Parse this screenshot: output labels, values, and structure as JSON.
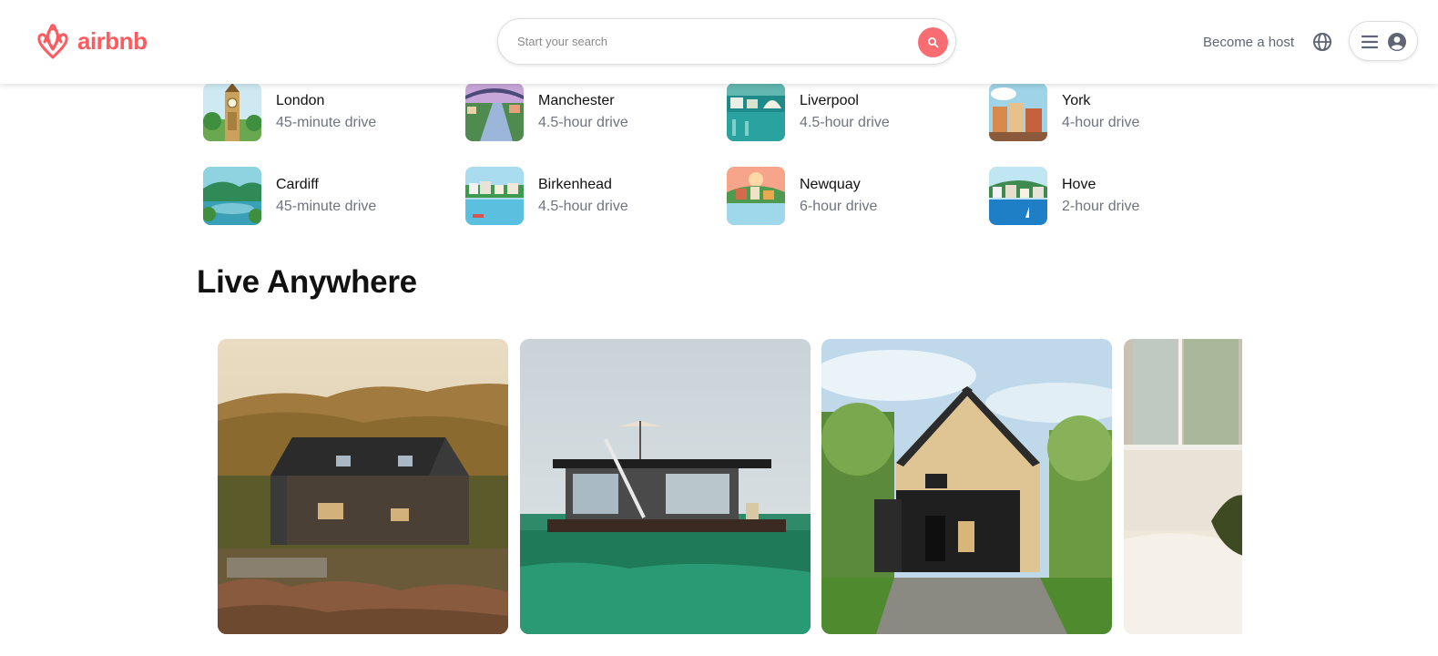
{
  "brand": {
    "name": "airbnb",
    "color": "#FF5A5F"
  },
  "header": {
    "search": {
      "placeholder": "Start your search",
      "button_icon": "search-icon",
      "button_color": "#F86D72"
    },
    "host_link": "Become a host",
    "globe_icon": "globe-icon",
    "menu_icon": "hamburger-menu-icon",
    "user_icon": "user-circle-icon"
  },
  "destinations": [
    {
      "city": "London",
      "distance": "45-minute drive"
    },
    {
      "city": "Manchester",
      "distance": "4.5-hour drive"
    },
    {
      "city": "Liverpool",
      "distance": "4.5-hour drive"
    },
    {
      "city": "York",
      "distance": "4-hour drive"
    },
    {
      "city": "Cardiff",
      "distance": "45-minute drive"
    },
    {
      "city": "Birkenhead",
      "distance": "4.5-hour drive"
    },
    {
      "city": "Newquay",
      "distance": "6-hour drive"
    },
    {
      "city": "Hove",
      "distance": "2-hour drive"
    }
  ],
  "live_anywhere": {
    "title": "Live Anywhere",
    "cards": [
      {
        "image": "wooden-cottage-hillside"
      },
      {
        "image": "floating-houseboat"
      },
      {
        "image": "a-frame-cabin"
      },
      {
        "image": "bedroom-interior"
      }
    ]
  }
}
